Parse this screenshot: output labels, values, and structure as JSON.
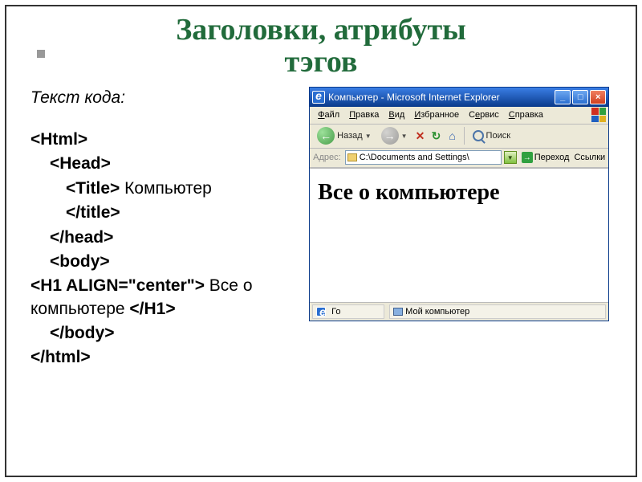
{
  "slide": {
    "title_line1": "Заголовки, атрибуты",
    "title_line2": "тэгов",
    "subtitle": "Текст кода:"
  },
  "code": {
    "l1": "<Html>",
    "l2": "<Head>",
    "l3a": "<Title>",
    "l3b": " Компьютер ",
    "l3c": "</title>",
    "l4": "</head>",
    "l5": "<body>",
    "l6a": "<H1 ALIGN=\"center\">",
    "l6b": " Все о компьютере ",
    "l6c": "</H1>",
    "l7": "</body>",
    "l8": "</html>"
  },
  "browser": {
    "window_title": "Компьютер - Microsoft Internet Explorer",
    "menu": {
      "file": "Файл",
      "edit": "Правка",
      "view": "Вид",
      "favorites": "Избранное",
      "tools": "Сервис",
      "help": "Справка"
    },
    "toolbar": {
      "back": "Назад",
      "search": "Поиск"
    },
    "address": {
      "label": "Адрес:",
      "path": "C:\\Documents and Settings\\",
      "go": "Переход",
      "links": "Ссылки"
    },
    "page_heading": "Все о компьютере",
    "status": {
      "left": "Го",
      "zone": "Мой компьютер"
    }
  }
}
